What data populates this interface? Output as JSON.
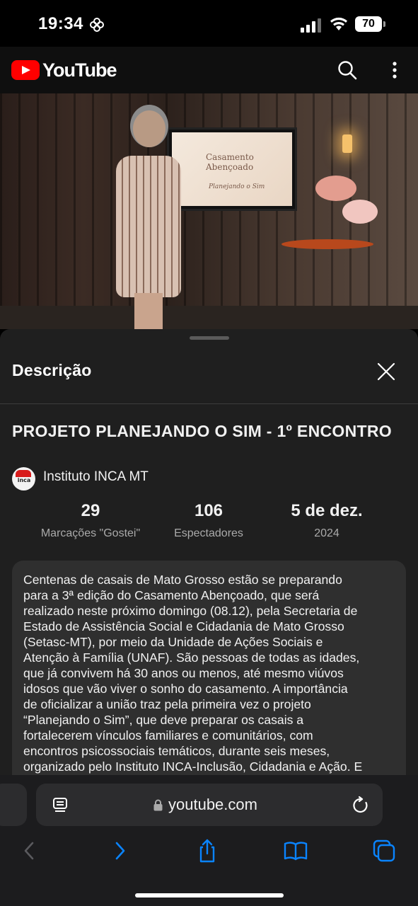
{
  "status_bar": {
    "time": "19:34",
    "battery": "70"
  },
  "header": {
    "logo_text": "YouTube",
    "icons": [
      "search-icon",
      "more-vert-icon"
    ],
    "brand_color": "#ff0000"
  },
  "video": {
    "tv_screen_title": "Casamento Abençoado",
    "tv_screen_subtitle": "Planejando o Sim"
  },
  "description_panel": {
    "title": "Descrição",
    "video_title": "PROJETO PLANEJANDO O SIM - 1º ENCONTRO",
    "channel": {
      "name": "Instituto INCA MT",
      "avatar_text": "inca"
    },
    "stats": [
      {
        "value": "29",
        "label": "Marcações \"Gostei\""
      },
      {
        "value": "106",
        "label": "Espectadores"
      },
      {
        "value": "5 de dez.",
        "label": "2024"
      }
    ],
    "description": "Centenas de casais de Mato Grosso estão se preparando\npara a 3ª edição do Casamento Abençoado, que será\nrealizado neste próximo domingo (08.12), pela Secretaria de\nEstado de Assistência Social e Cidadania de Mato Grosso\n(Setasc-MT), por meio da Unidade de Ações Sociais e\nAtenção à Família (UNAF). São pessoas de todas as idades,\nque já convivem há 30 anos ou menos, até mesmo viúvos\nidosos que vão viver o sonho do casamento. A importância\nde oficializar a união traz pela primeira vez o projeto\n“Planejando o Sim”, que deve preparar os casais a\nfortalecerem vínculos familiares e comunitários, com\nencontros psicossociais temáticos, durante seis meses,\norganizado pelo Instituto INCA-Inclusão, Cidadania e Ação. E"
  },
  "browser": {
    "url": "youtube.com",
    "toolbar_icons": [
      "back-icon",
      "forward-icon",
      "share-icon",
      "bookmarks-icon",
      "tabs-icon"
    ],
    "accent_color": "#0a84ff"
  }
}
